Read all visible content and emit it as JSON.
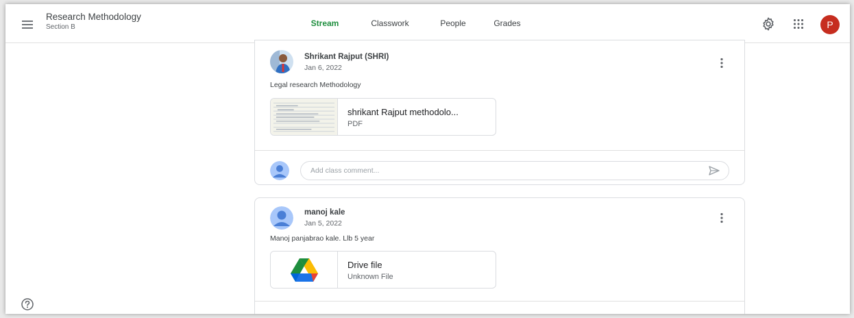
{
  "header": {
    "class_title": "Research Methodology",
    "class_section": "Section B",
    "tabs": [
      {
        "label": "Stream",
        "active": true
      },
      {
        "label": "Classwork",
        "active": false
      },
      {
        "label": "People",
        "active": false
      },
      {
        "label": "Grades",
        "active": false
      }
    ],
    "icons": [
      "menu-icon",
      "gear-icon",
      "apps-grid-icon"
    ],
    "account_initial": "P",
    "accent_color": "#1e8e3e",
    "account_color": "#c62d1f"
  },
  "posts": [
    {
      "author": "Shrikant Rajput (SHRI)",
      "date": "Jan 6, 2022",
      "text": "Legal research Methodology",
      "attachment": {
        "title": "shrikant Rajput methodolo...",
        "type": "PDF",
        "icon": "pdf-thumbnail"
      },
      "comment_placeholder": "Add class comment..."
    },
    {
      "author": "manoj kale",
      "date": "Jan 5, 2022",
      "text": "Manoj panjabrao kale. Llb 5 year",
      "attachment": {
        "title": "Drive file",
        "type": "Unknown File",
        "icon": "google-drive-icon"
      }
    }
  ],
  "footer": {
    "help_icon": "help-icon"
  }
}
